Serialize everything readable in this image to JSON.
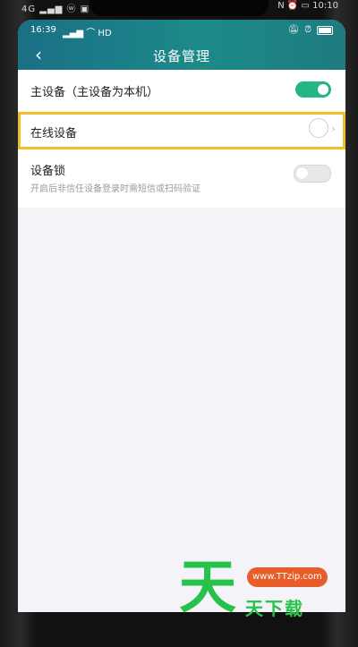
{
  "outer_status": {
    "left": "4G ▂▄▆ ⓦ ▣",
    "right": "N ⏰ ▭ 10:10"
  },
  "status_bar": {
    "time": "16:39",
    "network": "▂▄▆ ⌒ HD",
    "right_icons": [
      "silent-icon",
      "alarm-icon",
      "battery-icon"
    ]
  },
  "header": {
    "back_icon": "chevron-left-icon",
    "title": "设备管理"
  },
  "settings": {
    "main_device": {
      "label": "主设备（主设备为本机）",
      "toggle_on": true
    },
    "online_devices": {
      "label": "在线设备",
      "chevron": "›"
    },
    "device_lock": {
      "label": "设备锁",
      "description": "开启后非信任设备登录时需短信或扫码验证",
      "toggle_on": false
    }
  },
  "watermark": {
    "big_char": "天",
    "url": "www.TTzip.com",
    "text": "天下载"
  },
  "colors": {
    "header_start": "#1a6f85",
    "header_end": "#1e7b7f",
    "toggle_on": "#23b784",
    "highlight": "#f2bf2a",
    "watermark_green": "#26c24a",
    "watermark_orange": "#e85d2a"
  }
}
